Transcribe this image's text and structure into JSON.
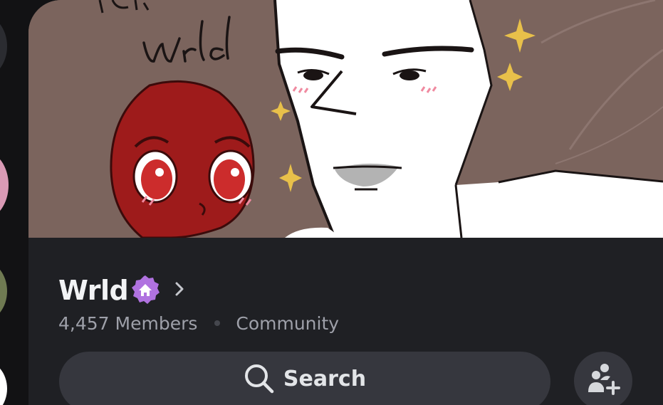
{
  "server": {
    "name": "Wrld",
    "members": "4,457 Members",
    "type": "Community",
    "badge_icon": "home-badge-icon",
    "chevron_icon": "chevron-right-icon"
  },
  "banner": {
    "handwritten_text": "Wrld",
    "handwritten_partial": "Bitt"
  },
  "search": {
    "label": "Search",
    "icon": "search-icon"
  },
  "invite": {
    "icon": "add-member-icon"
  },
  "colors": {
    "panel_bg": "#1f2024",
    "rail_bg": "#121214",
    "search_bg": "#36373e",
    "badge": "#b072e0"
  }
}
